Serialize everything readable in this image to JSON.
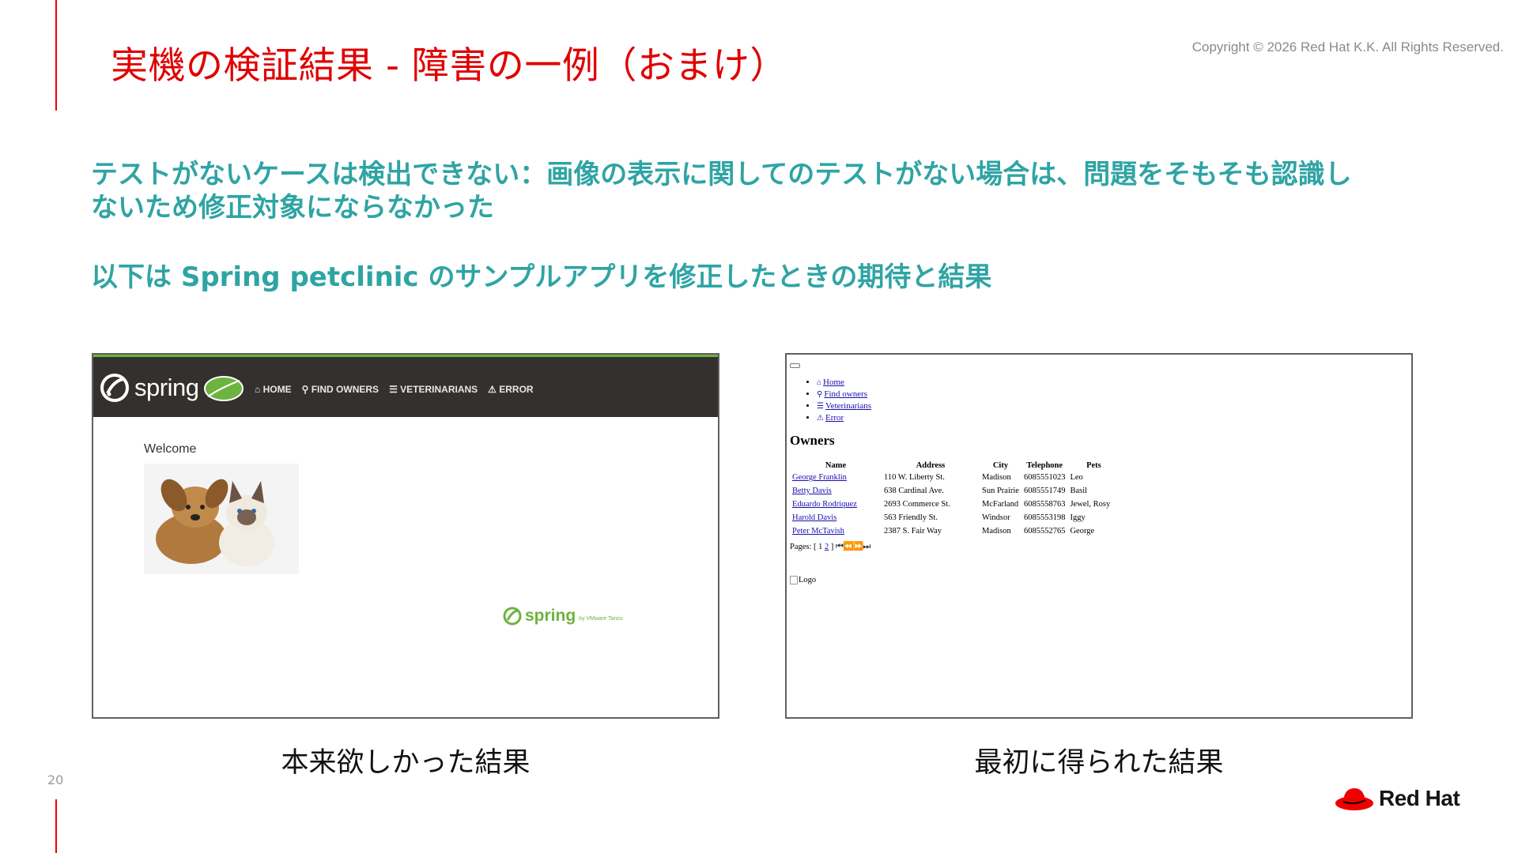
{
  "slide": {
    "title": "実機の検証結果 - 障害の一例（おまけ）",
    "copyright": "Copyright © 2026 Red Hat K.K. All Rights Reserved.",
    "body_line1": "テストがないケースは検出できない：画像の表示に関してのテストがない場合は、問題をそもそも認識しないため修正対象にならなかった",
    "body_line2": "以下は Spring petclinic のサンプルアプリを修正したときの期待と結果",
    "caption_left": "本来欲しかった結果",
    "caption_right": "最初に得られた結果",
    "page_number": "20",
    "logo_text": "Red Hat"
  },
  "expected_app": {
    "brand": "spring",
    "menu": [
      "HOME",
      "FIND OWNERS",
      "VETERINARIANS",
      "ERROR"
    ],
    "menu_icons": [
      "home-icon",
      "search-icon",
      "list-icon",
      "warning-icon"
    ],
    "welcome": "Welcome",
    "footer_brand": "spring",
    "footer_by": "by VMware Tanzu",
    "accent_color": "#6db33f",
    "nav_color": "#34302d"
  },
  "actual_app": {
    "nav_links": [
      "Home",
      "Find owners",
      "Veterinarians",
      "Error"
    ],
    "heading": "Owners",
    "table": {
      "columns": [
        "Name",
        "Address",
        "City",
        "Telephone",
        "Pets"
      ],
      "rows": [
        [
          "George Franklin",
          "110 W. Liberty St.",
          "Madison",
          "6085551023",
          "Leo"
        ],
        [
          "Betty Davis",
          "638 Cardinal Ave.",
          "Sun Prairie",
          "6085551749",
          "Basil"
        ],
        [
          "Eduardo Rodriquez",
          "2693 Commerce St.",
          "McFarland",
          "6085558763",
          "Jewel, Rosy"
        ],
        [
          "Harold Davis",
          "563 Friendly St.",
          "Windsor",
          "6085553198",
          "Iggy"
        ],
        [
          "Peter McTavish",
          "2387 S. Fair Way",
          "Madison",
          "6085552765",
          "George"
        ]
      ]
    },
    "pages_label": "Pages: [",
    "page_1": "1",
    "page_2": "2",
    "pages_end": "]",
    "logo_alt": "Logo"
  },
  "colors": {
    "title": "#e00000",
    "body_text": "#2fa4a4",
    "rule": "#ee0000"
  }
}
